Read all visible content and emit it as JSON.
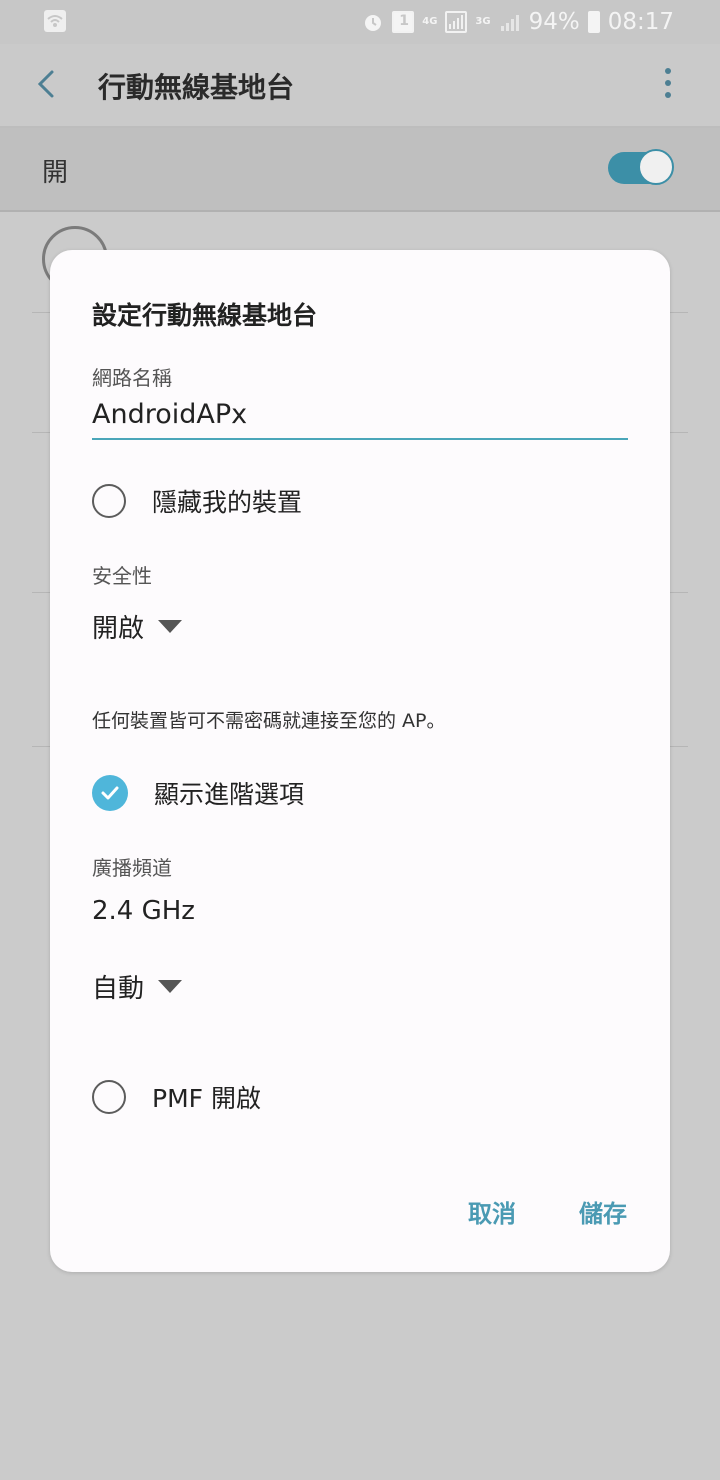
{
  "status_bar": {
    "battery": "94%",
    "time": "08:17",
    "network_1": "4G",
    "network_2": "3G",
    "sim": "1",
    "icons": [
      "wifi-hotspot-icon",
      "alarm-icon",
      "sim-icon",
      "signal-icon",
      "battery-icon"
    ]
  },
  "app_bar": {
    "title": "行動無線基地台"
  },
  "hotspot_switch": {
    "label": "開",
    "state": true,
    "accent": "#3c8fa7"
  },
  "dialog": {
    "title": "設定行動無線基地台",
    "network_name_label": "網路名稱",
    "network_name_value": "AndroidAPx",
    "hide_device_label": "隱藏我的裝置",
    "hide_device_checked": false,
    "security_label": "安全性",
    "security_value": "開啟",
    "security_description": "任何裝置皆可不需密碼就連接至您的 AP。",
    "advanced_label": "顯示進階選項",
    "advanced_checked": true,
    "broadcast_channel_label": "廣播頻道",
    "band_value": "2.4 GHz",
    "channel_value": "自動",
    "pmf_label": "PMF 開啟",
    "pmf_checked": false,
    "cancel_label": "取消",
    "save_label": "儲存"
  }
}
